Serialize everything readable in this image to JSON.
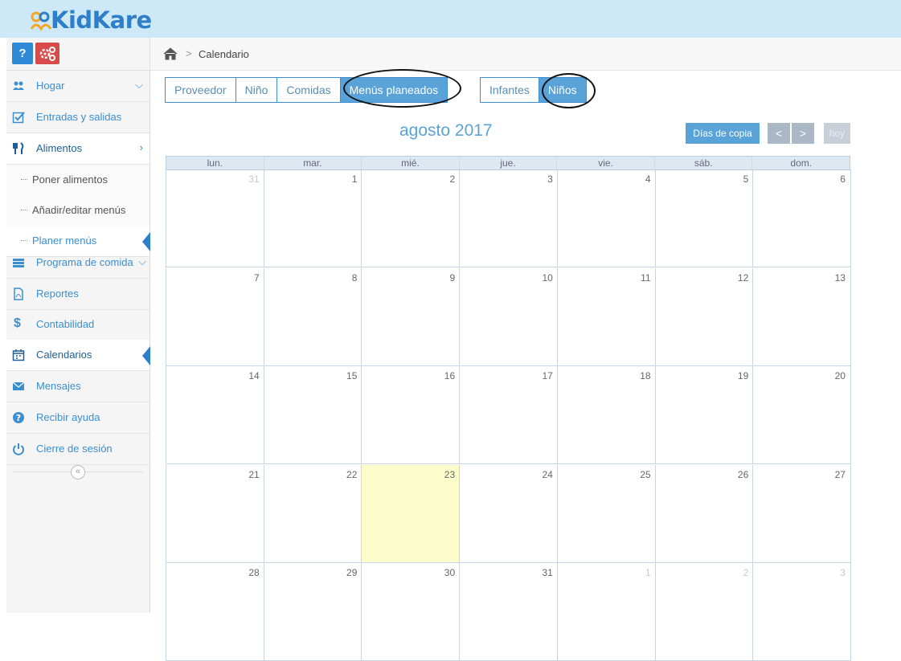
{
  "app": {
    "name": "KidKare"
  },
  "toolbar": {
    "help_label": "?"
  },
  "sidebar": {
    "items": [
      {
        "label": "Hogar",
        "icon": "users-icon"
      },
      {
        "label": "Entradas y salidas",
        "icon": "checkbox-icon"
      },
      {
        "label": "Alimentos",
        "icon": "fork-knife-icon"
      },
      {
        "label": "Poner alimentos"
      },
      {
        "label": "Añadir/editar menús"
      },
      {
        "label": "Planer menús"
      },
      {
        "label": "Programa de comida",
        "icon": "list-icon"
      },
      {
        "label": "Reportes",
        "icon": "pdf-icon"
      },
      {
        "label": "Contabilidad",
        "icon": "dollar-icon"
      },
      {
        "label": "Calendarios",
        "icon": "calendar-icon"
      },
      {
        "label": "Mensajes",
        "icon": "envelope-icon"
      },
      {
        "label": "Recibir ayuda",
        "icon": "question-icon"
      },
      {
        "label": "Cierre de sesión",
        "icon": "power-icon"
      }
    ],
    "collapse_label": "«"
  },
  "breadcrumb": {
    "sep": ">",
    "current": "Calendario"
  },
  "tabs": [
    "Proveedor",
    "Niño",
    "Comidas",
    "Menús planeados"
  ],
  "tabs2": [
    "Infantes",
    "Niños"
  ],
  "calendar": {
    "month": "agosto 2017",
    "copy_label": "Días de copia",
    "prev": "<",
    "next": ">",
    "today_label": "hoy",
    "weekdays": [
      "lun.",
      "mar.",
      "mié.",
      "jue.",
      "vie.",
      "sáb.",
      "dom."
    ],
    "weeks": [
      [
        "31",
        "1",
        "2",
        "3",
        "4",
        "5",
        "6"
      ],
      [
        "7",
        "8",
        "9",
        "10",
        "11",
        "12",
        "13"
      ],
      [
        "14",
        "15",
        "16",
        "17",
        "18",
        "19",
        "20"
      ],
      [
        "21",
        "22",
        "23",
        "24",
        "25",
        "26",
        "27"
      ],
      [
        "28",
        "29",
        "30",
        "31",
        "1",
        "2",
        "3"
      ]
    ],
    "other_month": [
      [
        0,
        0
      ],
      [
        4,
        4
      ],
      [
        4,
        5
      ],
      [
        4,
        6
      ]
    ],
    "today": [
      3,
      2
    ]
  },
  "colors": {
    "accent": "#5aa3d9",
    "header": "#cde9f8",
    "today": "#fdfccb"
  }
}
